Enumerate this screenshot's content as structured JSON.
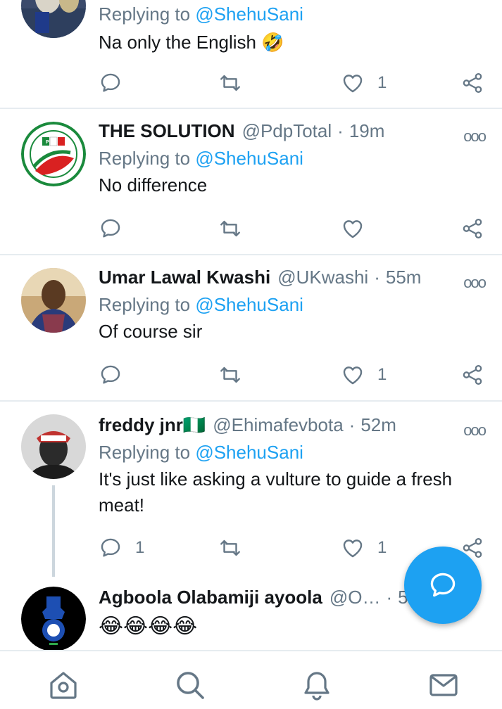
{
  "tweets": [
    {
      "name": "",
      "handle": "",
      "time": "",
      "replying_prefix": "Replying to ",
      "replying_to": "@ShehuSani",
      "text": "Na only the English 🤣",
      "replies": "",
      "likes": "1"
    },
    {
      "name": "THE SOLUTION",
      "handle": "@PdpTotal",
      "separator": "·",
      "time": "19m",
      "replying_prefix": "Replying to ",
      "replying_to": "@ShehuSani",
      "text": "No difference",
      "replies": "",
      "likes": ""
    },
    {
      "name": "Umar Lawal Kwashi",
      "handle": "@UKwashi",
      "separator": "·",
      "time": "55m",
      "replying_prefix": "Replying to ",
      "replying_to": "@ShehuSani",
      "text": "Of course sir",
      "replies": "",
      "likes": "1"
    },
    {
      "name": "freddy jnr🇳🇬",
      "handle": "@Ehimafevbota",
      "separator": "·",
      "time": "52m",
      "replying_prefix": "Replying to ",
      "replying_to": "@ShehuSani",
      "text": "It's just like asking a vulture to guide a fresh meat!",
      "replies": "1",
      "likes": "1"
    },
    {
      "name": "Agboola Olabamiji ayoola",
      "handle": "@O…",
      "separator": "·",
      "time": "5",
      "text": "😂😂😂😂"
    }
  ],
  "more_menu_glyph": "ooo",
  "compose_button": "reply-compose-icon",
  "bottom_nav": [
    "home-icon",
    "search-icon",
    "notifications-icon",
    "messages-icon"
  ],
  "colors": {
    "accent": "#1da1f2",
    "secondary_text": "#657786",
    "divider": "#e6ecf0"
  }
}
